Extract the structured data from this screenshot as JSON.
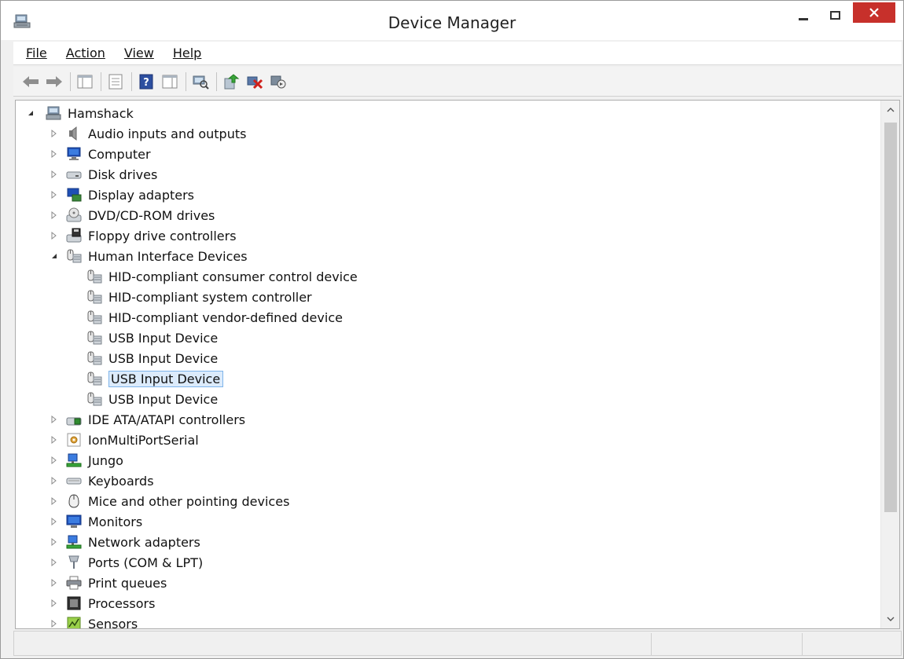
{
  "window": {
    "title": "Device Manager"
  },
  "menu": {
    "items": [
      {
        "label": "File"
      },
      {
        "label": "Action"
      },
      {
        "label": "View"
      },
      {
        "label": "Help"
      }
    ]
  },
  "toolbar": {
    "buttons": [
      "back-arrow-icon",
      "forward-arrow-icon",
      "show-hide-console-tree-icon",
      "properties-icon",
      "help-icon",
      "show-action-pane-icon",
      "scan-hardware-icon",
      "update-driver-icon",
      "uninstall-device-icon",
      "disable-device-icon"
    ]
  },
  "tree": {
    "root": {
      "label": "Hamshack",
      "expanded": true
    },
    "rows": [
      {
        "label": "Audio inputs and outputs",
        "icon": "speaker-icon",
        "level": 1,
        "expander": "collapsed"
      },
      {
        "label": "Computer",
        "icon": "computer-icon",
        "level": 1,
        "expander": "collapsed"
      },
      {
        "label": "Disk drives",
        "icon": "disk-drive-icon",
        "level": 1,
        "expander": "collapsed"
      },
      {
        "label": "Display adapters",
        "icon": "display-adapter-icon",
        "level": 1,
        "expander": "collapsed"
      },
      {
        "label": "DVD/CD-ROM drives",
        "icon": "dvd-drive-icon",
        "level": 1,
        "expander": "collapsed"
      },
      {
        "label": "Floppy drive controllers",
        "icon": "floppy-controller-icon",
        "level": 1,
        "expander": "collapsed"
      },
      {
        "label": "Human Interface Devices",
        "icon": "hid-icon",
        "level": 1,
        "expander": "expanded"
      },
      {
        "label": "HID-compliant consumer control device",
        "icon": "hid-icon",
        "level": 2,
        "expander": "none"
      },
      {
        "label": "HID-compliant system controller",
        "icon": "hid-icon",
        "level": 2,
        "expander": "none"
      },
      {
        "label": "HID-compliant vendor-defined device",
        "icon": "hid-icon",
        "level": 2,
        "expander": "none"
      },
      {
        "label": "USB Input Device",
        "icon": "hid-icon",
        "level": 2,
        "expander": "none"
      },
      {
        "label": "USB Input Device",
        "icon": "hid-icon",
        "level": 2,
        "expander": "none"
      },
      {
        "label": "USB Input Device",
        "icon": "hid-icon",
        "level": 2,
        "expander": "none",
        "selected": true
      },
      {
        "label": "USB Input Device",
        "icon": "hid-icon",
        "level": 2,
        "expander": "none"
      },
      {
        "label": "IDE ATA/ATAPI controllers",
        "icon": "ide-controller-icon",
        "level": 1,
        "expander": "collapsed"
      },
      {
        "label": "IonMultiPortSerial",
        "icon": "gear-device-icon",
        "level": 1,
        "expander": "collapsed"
      },
      {
        "label": "Jungo",
        "icon": "network-device-icon",
        "level": 1,
        "expander": "collapsed"
      },
      {
        "label": "Keyboards",
        "icon": "keyboard-icon",
        "level": 1,
        "expander": "collapsed"
      },
      {
        "label": "Mice and other pointing devices",
        "icon": "mouse-icon",
        "level": 1,
        "expander": "collapsed"
      },
      {
        "label": "Monitors",
        "icon": "monitor-icon",
        "level": 1,
        "expander": "collapsed"
      },
      {
        "label": "Network adapters",
        "icon": "network-adapter-icon",
        "level": 1,
        "expander": "collapsed"
      },
      {
        "label": "Ports (COM & LPT)",
        "icon": "port-icon",
        "level": 1,
        "expander": "collapsed"
      },
      {
        "label": "Print queues",
        "icon": "printer-icon",
        "level": 1,
        "expander": "collapsed"
      },
      {
        "label": "Processors",
        "icon": "processor-icon",
        "level": 1,
        "expander": "collapsed"
      },
      {
        "label": "Sensors",
        "icon": "sensor-icon",
        "level": 1,
        "expander": "collapsed"
      }
    ]
  },
  "colors": {
    "close_button": "#c7302b",
    "selection_bg": "#dcebfb",
    "selection_border": "#7eb4ea"
  }
}
